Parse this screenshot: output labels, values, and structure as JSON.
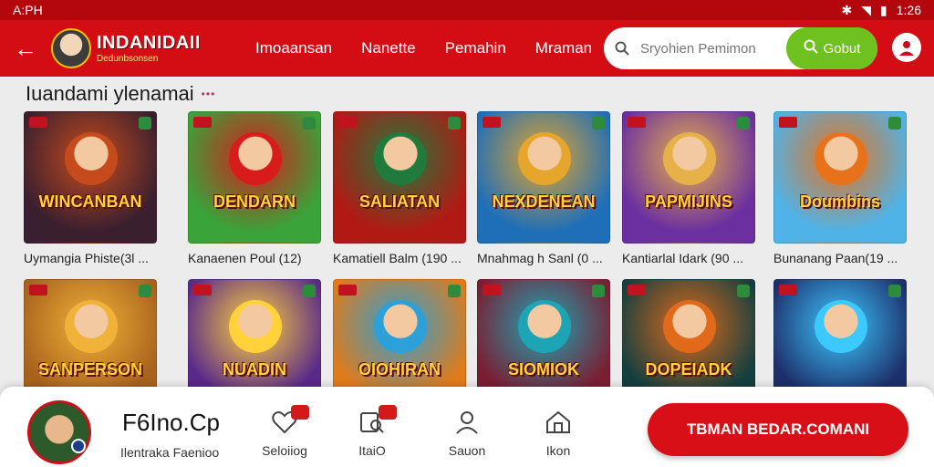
{
  "status_bar": {
    "left": "A:PH",
    "time": "1:26"
  },
  "app_bar": {
    "logo_title": "INDANIDAII",
    "logo_sub": "Dedunbsonsen",
    "nav": [
      "Imoaansan",
      "Nanette",
      "Pemahin",
      "Mraman"
    ],
    "search_placeholder": "Sryohien Pemimon",
    "search_button": "Gobut"
  },
  "section_title": "Iuandami ylenamai",
  "games": [
    {
      "caption": "Uymangia Phiste(3l ...",
      "art": "WINCANBAN",
      "bg": "#3a1f2f",
      "accent": "#c64b1c"
    },
    {
      "caption": "Kanaenen Poul (12)",
      "art": "DENDARN",
      "bg": "#3aa33a",
      "accent": "#d81b1b"
    },
    {
      "caption": "Kamatiell Balm (190 ...",
      "art": "SALIATAN",
      "bg": "#b11a14",
      "accent": "#1f7a3b"
    },
    {
      "caption": "Mnahmag h Sanl (0 ...",
      "art": "NEXDENEAN",
      "bg": "#1f6fb8",
      "accent": "#e6a52b"
    },
    {
      "caption": "Kantiarlal Idark (90 ...",
      "art": "PAPMIJINS",
      "bg": "#6b2fa0",
      "accent": "#e7b14a"
    },
    {
      "caption": "Bunanang Paan(19 ...",
      "art": "Doumbins",
      "bg": "#4fb3e8",
      "accent": "#e8721b"
    },
    {
      "caption": "",
      "art": "SANPERSON",
      "bg": "#a8621d",
      "accent": "#f0b238"
    },
    {
      "caption": "",
      "art": "NUADIN",
      "bg": "#5a2a8a",
      "accent": "#ffd23b"
    },
    {
      "caption": "",
      "art": "OIOHIRAN",
      "bg": "#e07b1a",
      "accent": "#2ca0d8"
    },
    {
      "caption": "",
      "art": "SIOMIOK",
      "bg": "#7a1f33",
      "accent": "#1da5b5"
    },
    {
      "caption": "",
      "art": "DOPEIADK",
      "bg": "#153f3f",
      "accent": "#e06a1a"
    },
    {
      "caption": "",
      "art": "",
      "bg": "#1d2f6b",
      "accent": "#3cc9ff"
    }
  ],
  "bottom_bar": {
    "user_name": "F6Ino.Cp",
    "user_sub": "Ilentraka Faenioo",
    "tabs": [
      {
        "label": "Seloiiog",
        "icon": "heart-chat-icon",
        "notif": true
      },
      {
        "label": "ItaiO",
        "icon": "search-doc-icon",
        "notif": true
      },
      {
        "label": "Sauon",
        "icon": "person-icon",
        "notif": false
      },
      {
        "label": "Ikon",
        "icon": "home-icon",
        "notif": false
      }
    ],
    "cta": "TBMAN BEDAR.COMANI"
  },
  "colors": {
    "primary_red": "#d40d14",
    "search_green": "#6fc11f"
  }
}
